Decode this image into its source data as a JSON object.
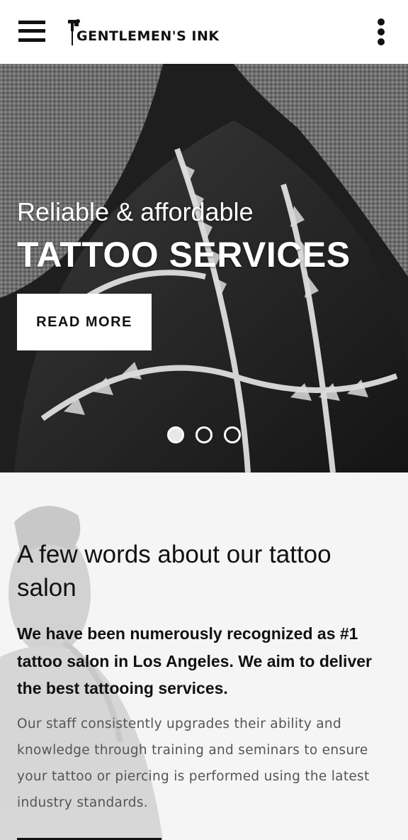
{
  "header": {
    "menu_icon": "hamburger-menu-icon",
    "logo_text": "GENTLEMEN'S INK",
    "more_icon": "vertical-dots-icon"
  },
  "hero": {
    "subtitle": "Reliable & affordable",
    "title": "TATTOO SERVICES",
    "cta_label": "READ MORE",
    "slides_count": 3,
    "active_slide": 1
  },
  "about": {
    "heading": "A few words about our tattoo salon",
    "lead": "We have been numerously recognized as #1 tattoo salon in Los Angeles. We aim to deliver the best tattooing services.",
    "body": "Our staff consistently upgrades their ability and knowledge through training and seminars to ensure your tattoo or piercing is performed using the latest industry standards."
  },
  "colors": {
    "text": "#111111",
    "muted": "#555555",
    "background": "#ffffff"
  }
}
